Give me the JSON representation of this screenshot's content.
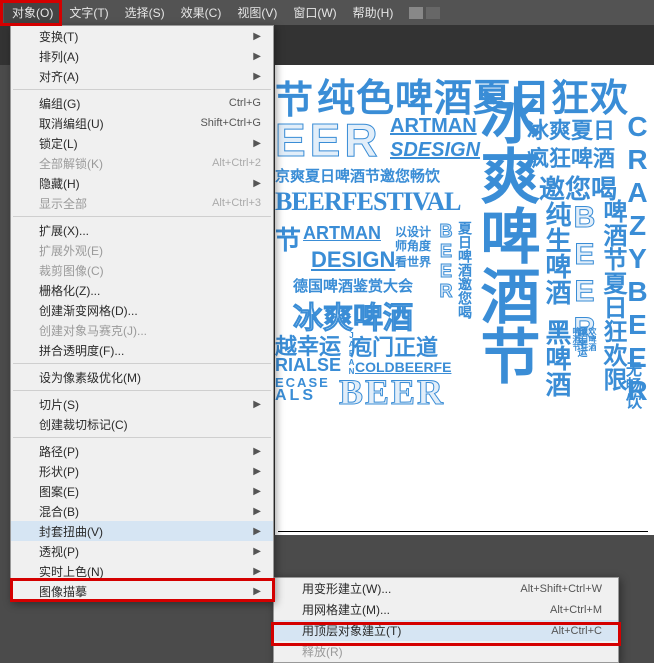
{
  "menubar": {
    "object": "对象(O)",
    "text": "文字(T)",
    "select": "选择(S)",
    "effect": "效果(C)",
    "view": "视图(V)",
    "window": "窗口(W)",
    "help": "帮助(H)"
  },
  "object_menu": {
    "transform": "变换(T)",
    "arrange": "排列(A)",
    "align": "对齐(A)",
    "group": "编组(G)",
    "group_sc": "Ctrl+G",
    "ungroup": "取消编组(U)",
    "ungroup_sc": "Shift+Ctrl+G",
    "lock": "锁定(L)",
    "unlock_all": "全部解锁(K)",
    "unlock_all_sc": "Alt+Ctrl+2",
    "hide": "隐藏(H)",
    "show_all": "显示全部",
    "show_all_sc": "Alt+Ctrl+3",
    "expand": "扩展(X)...",
    "expand_appearance": "扩展外观(E)",
    "crop_image": "裁剪图像(C)",
    "rasterize": "栅格化(Z)...",
    "gradient_mesh": "创建渐变网格(D)...",
    "object_mosaic": "创建对象马赛克(J)...",
    "flatten": "拼合透明度(F)...",
    "pixel_perfect": "设为像素级优化(M)",
    "slice": "切片(S)",
    "crop_marks": "创建裁切标记(C)",
    "path": "路径(P)",
    "shape": "形状(P)",
    "pattern": "图案(E)",
    "blend": "混合(B)",
    "envelope": "封套扭曲(V)",
    "perspective": "透视(P)",
    "live_paint": "实时上色(N)",
    "image_trace": "图像描摹"
  },
  "envelope_submenu": {
    "warp": "用变形建立(W)...",
    "warp_sc": "Alt+Shift+Ctrl+W",
    "mesh": "用网格建立(M)...",
    "mesh_sc": "Alt+Ctrl+M",
    "top": "用顶层对象建立(T)",
    "top_sc": "Alt+Ctrl+C",
    "release": "释放(R)"
  },
  "canvas": {
    "w1": "节",
    "w2": "纯色啤酒夏日狂欢",
    "w3": "EER",
    "w4": "ARTMAN",
    "w5": "SDESIGN",
    "w6": "冰爽夏日",
    "w7": "疯狂啤酒",
    "w8": "京爽夏日啤酒节邀您畅饮",
    "w9": "邀您喝",
    "w10": "BEERFESTIVAL",
    "w11": "节",
    "w12": "ARTMAN",
    "w13": "DESIGN",
    "w14": "以设计",
    "w15": "师角度",
    "w16": "看世界",
    "w17": "德国啤酒鉴赏大会",
    "w18": "冰爽啤酒",
    "w19": "越幸运",
    "w20": "庖门正道",
    "w21": "RIALSE",
    "w22": "COLDBEERFE",
    "w23": "ECASE",
    "w24": "ALS",
    "w25": "BEER",
    "w26": "冰爽啤酒节",
    "w27": "纯生啤酒",
    "w28": "黑啤酒",
    "w29": "BEER",
    "w30": "啤酒节夏日狂欢限",
    "w31": "CRAZYBEER",
    "w32": "JAPAN",
    "w33": "BEER",
    "w34": "夏日啤酒邀您喝",
    "w35": "越幸运",
    "w36": "啤酒节",
    "w37": "夏日狂",
    "w38": "欢啤酒",
    "w39": "无畅饮"
  }
}
